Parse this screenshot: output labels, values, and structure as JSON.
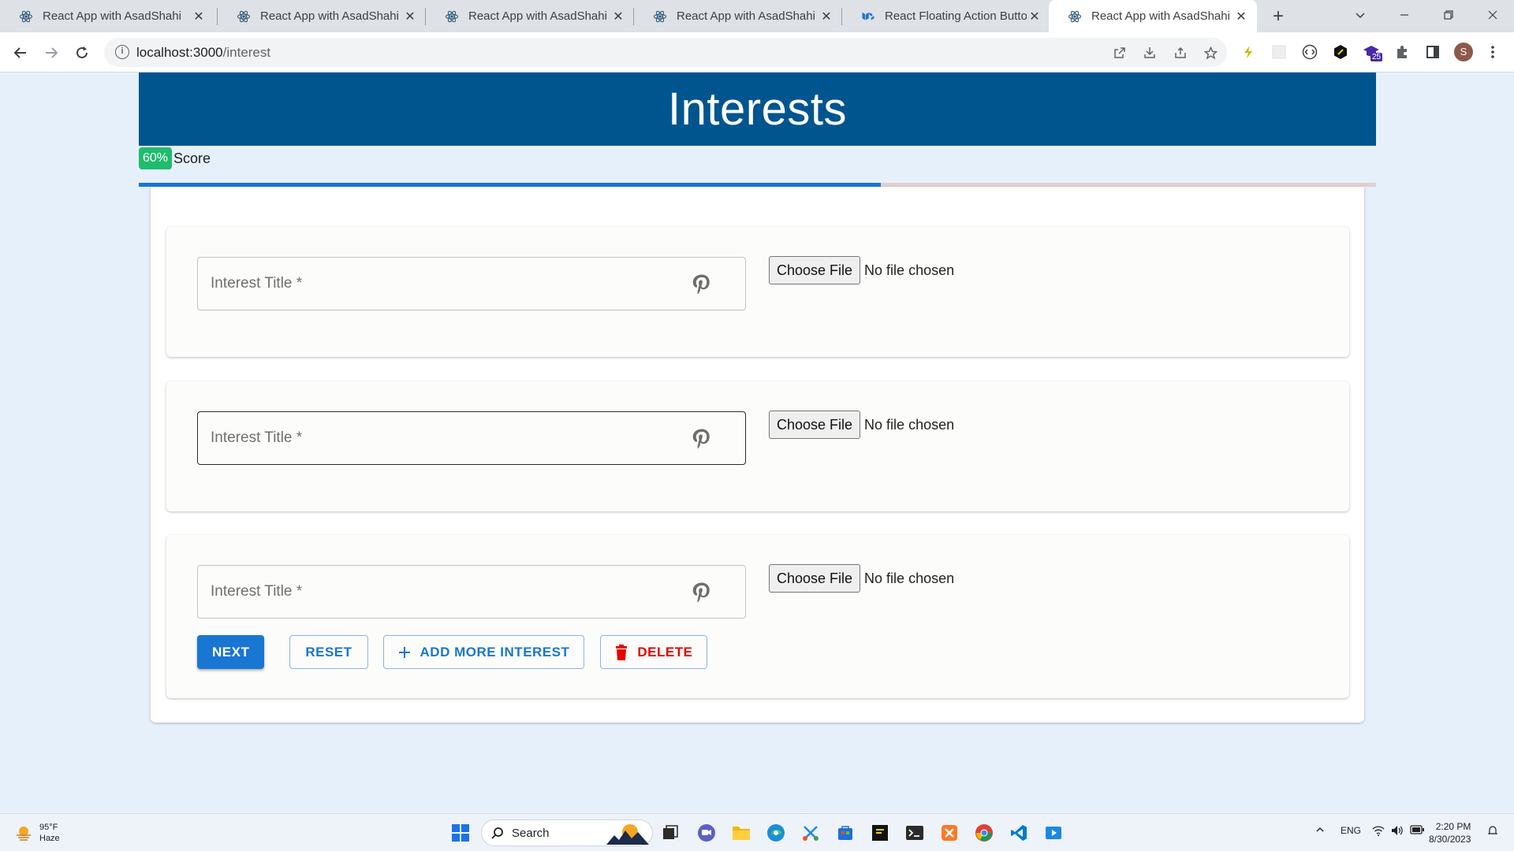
{
  "browser": {
    "tabs": [
      {
        "title": "React App with AsadShahi",
        "icon": "react-icon"
      },
      {
        "title": "React App with AsadShahi",
        "icon": "react-icon"
      },
      {
        "title": "React App with AsadShahi",
        "icon": "react-icon"
      },
      {
        "title": "React App with AsadShahi",
        "icon": "react-icon"
      },
      {
        "title": "React Floating Action Button",
        "icon": "mui-icon"
      },
      {
        "title": "React App with AsadShahi",
        "icon": "react-icon",
        "active": true
      }
    ],
    "close_glyph": "✕",
    "new_tab_glyph": "+",
    "url_host": "localhost:3000",
    "url_path": "/interest",
    "profile_initial": "S",
    "extension_badge": "25"
  },
  "page": {
    "title": "Interests",
    "score_value": "60%",
    "score_label": "Score",
    "progress": 0.6,
    "cards": [
      {
        "placeholder": "Interest Title *",
        "choose_label": "Choose File",
        "file_status": "No file chosen"
      },
      {
        "placeholder": "Interest Title *",
        "choose_label": "Choose File",
        "file_status": "No file chosen",
        "focused": true
      },
      {
        "placeholder": "Interest Title *",
        "choose_label": "Choose File",
        "file_status": "No file chosen"
      }
    ],
    "actions": {
      "next": "NEXT",
      "reset": "RESET",
      "add_more": "ADD MORE INTEREST",
      "delete": "DELETE"
    }
  },
  "colors": {
    "header_bg": "#01558f",
    "score_badge": "#1fbc6d",
    "progress_fill": "#1976d2",
    "progress_track": "#e3cfcf",
    "primary": "#1976d2",
    "danger": "#e50000"
  },
  "taskbar": {
    "weather_temp": "95°F",
    "weather_desc": "Haze",
    "search_label": "Search",
    "language": "ENG",
    "time": "2:20 PM",
    "date": "8/30/2023"
  }
}
